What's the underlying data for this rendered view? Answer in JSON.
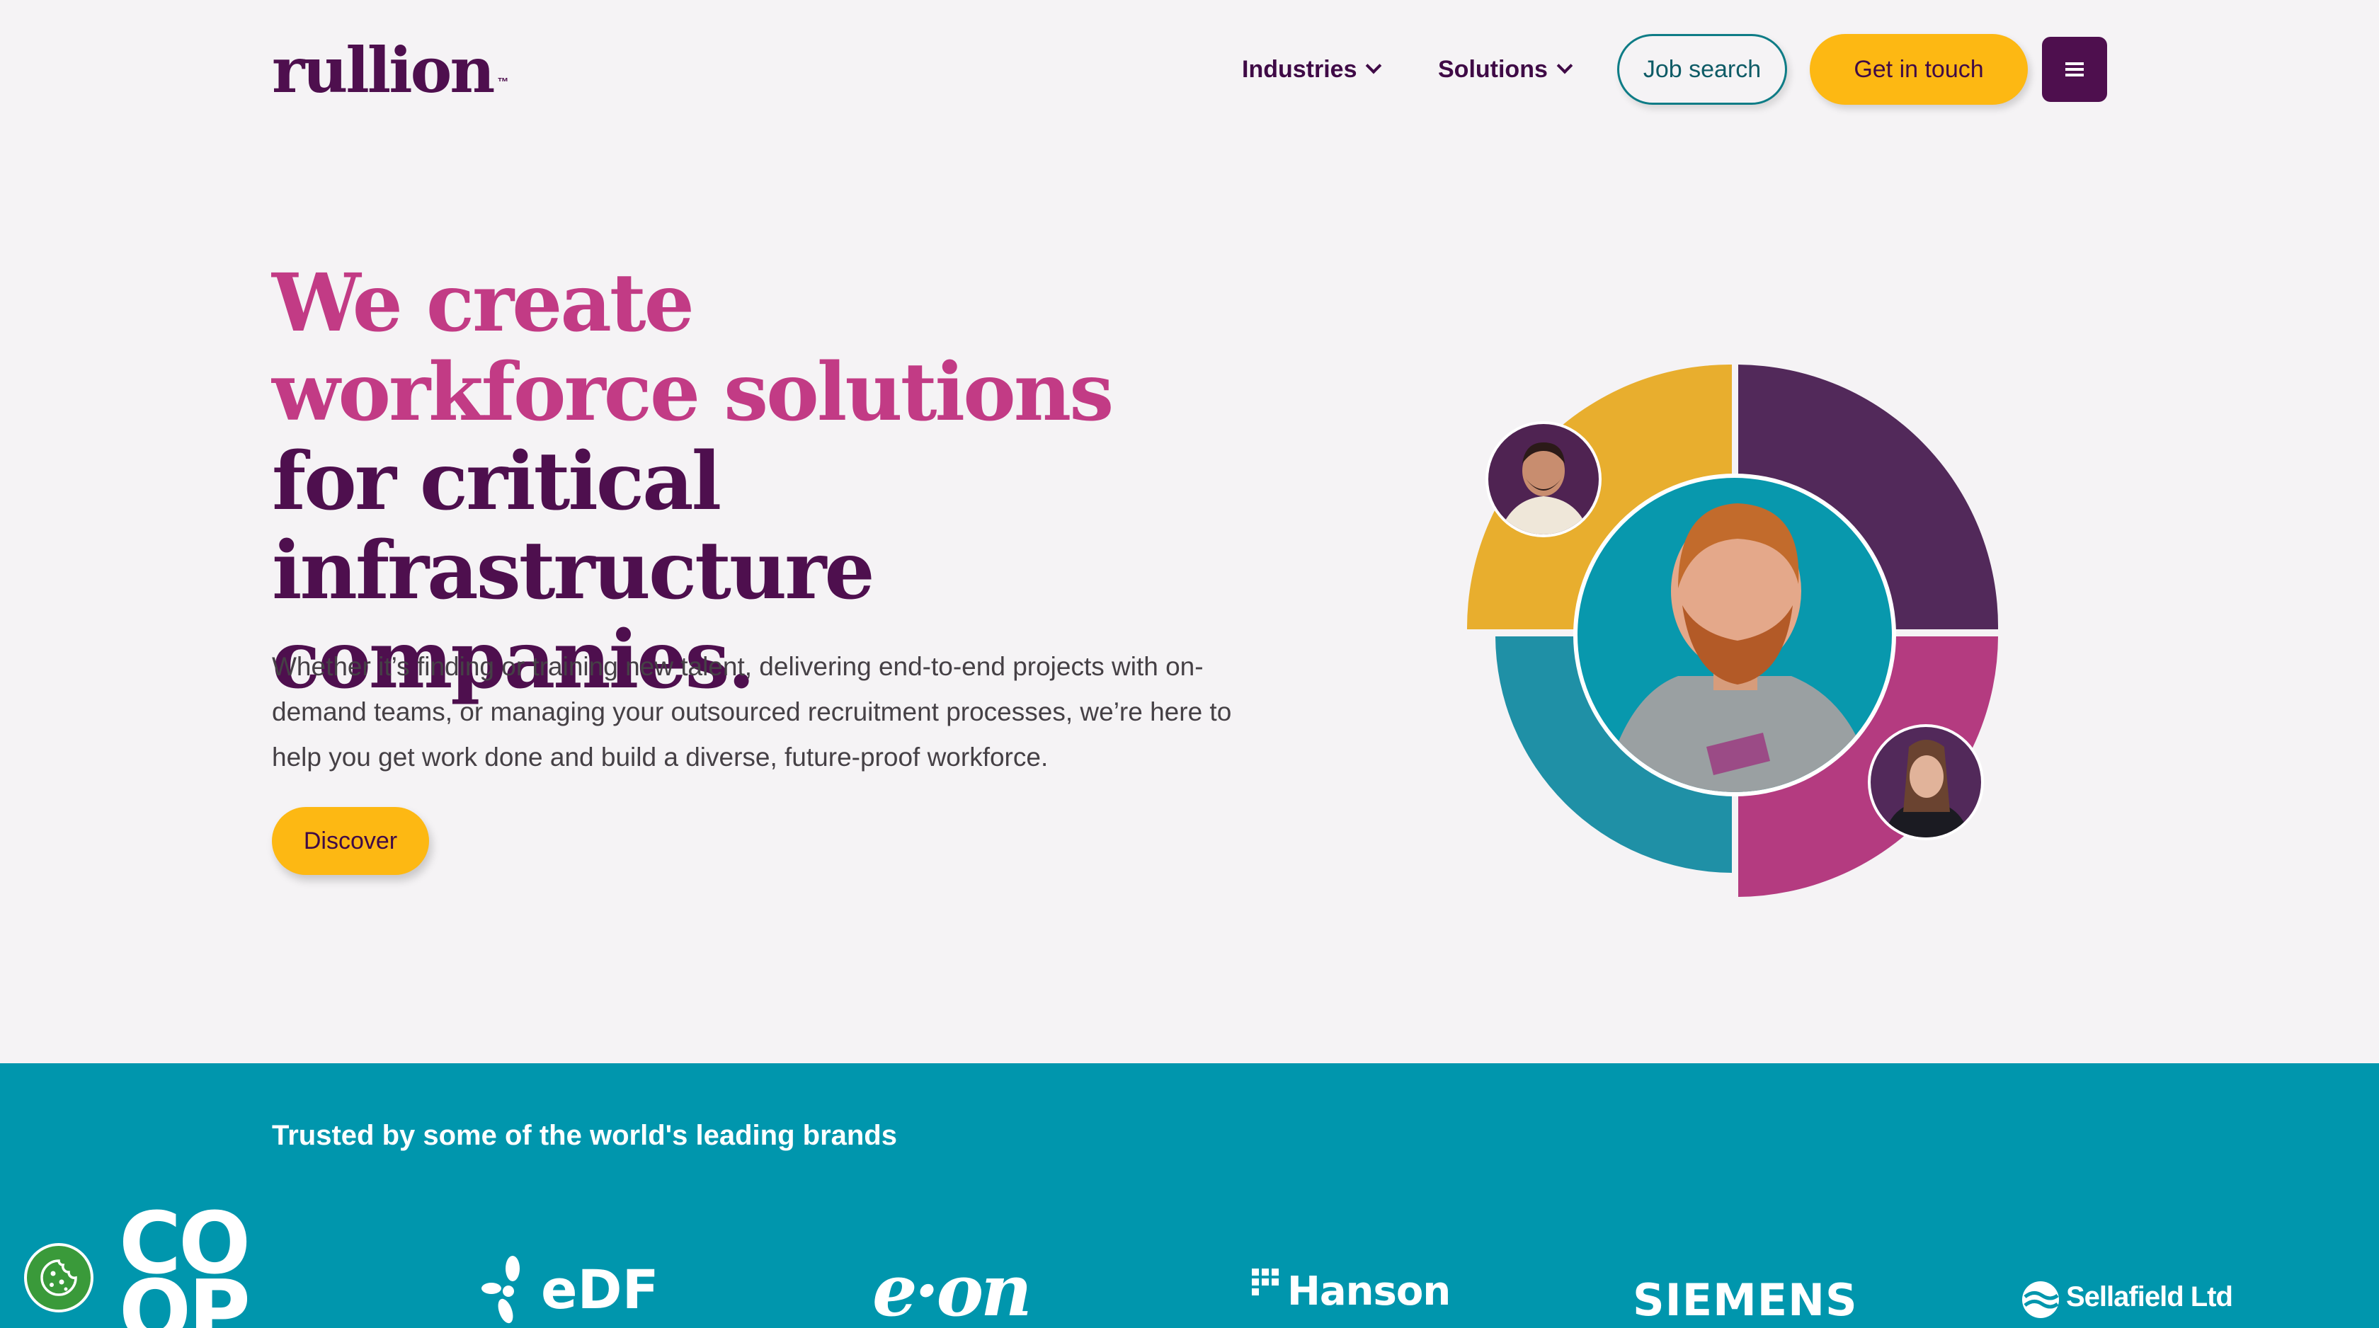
{
  "header": {
    "logo": "rullion",
    "logo_mark": "™",
    "nav": [
      {
        "label": "Industries"
      },
      {
        "label": "Solutions"
      }
    ],
    "job_search_label": "Job search",
    "get_in_touch_label": "Get in touch"
  },
  "hero": {
    "title_accent": "We create workforce solutions",
    "title_rest": " for critical infrastructure companies.",
    "copy": "Whether it’s finding or training new talent, delivering end-to-end projects with on-demand teams, or managing your outsourced recruitment processes, we’re here to help you get work done and build a diverse, future-proof workforce.",
    "discover_label": "Discover"
  },
  "brands": {
    "title": "Trusted by some of the world's leading brands",
    "logos": [
      {
        "name": "co-op",
        "text": "CO\nOP"
      },
      {
        "name": "edf",
        "text": "eDF"
      },
      {
        "name": "eon",
        "text": "e·on"
      },
      {
        "name": "hanson",
        "text": "Hanson"
      },
      {
        "name": "siemens",
        "text": "SIEMENS"
      },
      {
        "name": "sellafield",
        "text": "Sellafield Ltd"
      }
    ]
  },
  "colors": {
    "purple": "#4e0f4e",
    "magenta": "#c23b85",
    "yellow": "#fdb813",
    "teal": "#0096ad",
    "ring_yellow": "#e8ae2e",
    "ring_purple": "#52295a",
    "ring_teal": "#1f90a6",
    "ring_magenta": "#b43b80"
  },
  "icons": {
    "dropdown": "chevron-down-icon",
    "menu": "hamburger-menu-icon",
    "cookie": "cookie-icon"
  }
}
